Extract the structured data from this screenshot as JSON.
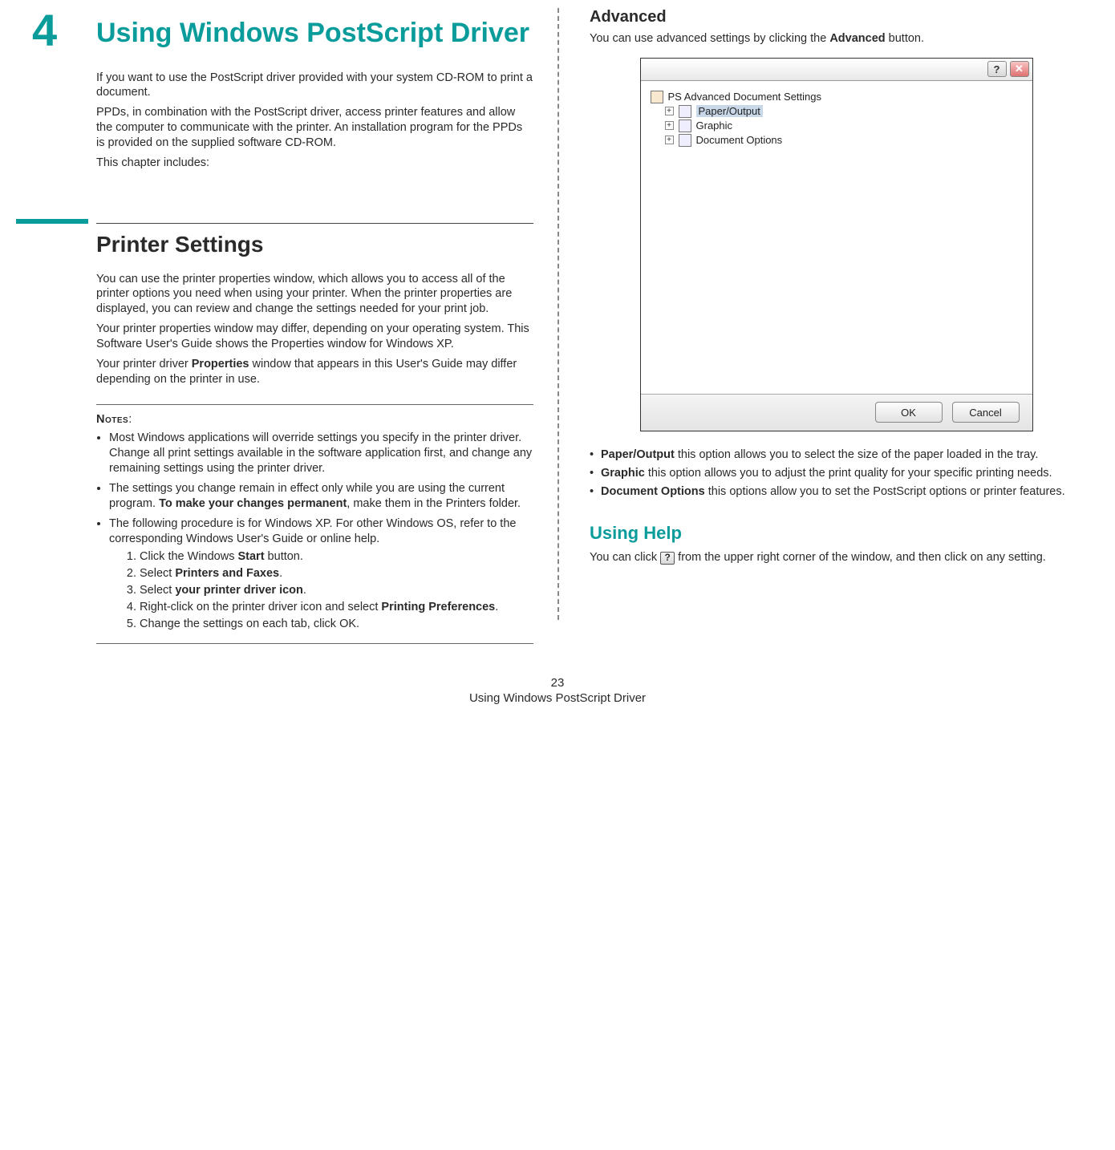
{
  "chapterNumber": "4",
  "chapterTitle": "Using Windows PostScript Driver",
  "intro1": "If you want to use the PostScript driver provided with your system CD-ROM to print a document.",
  "intro2": "PPDs, in combination with the PostScript driver, access printer features and allow the computer to communicate with the printer. An installation program for the PPDs is provided on the supplied software CD-ROM.",
  "intro3": "This chapter includes:",
  "section1_title": "Printer Settings",
  "section1_p1": "You can use the printer properties window, which allows you to access all of the printer options you need when using your printer. When the printer properties are displayed, you can review and change the settings needed for your print job.",
  "section1_p2": "Your printer properties window may differ, depending on your operating system. This Software User's Guide shows the Properties window for Windows XP.",
  "section1_p3a": "Your printer driver ",
  "section1_p3b": "Properties",
  "section1_p3c": " window that appears in this User's Guide may differ depending on the printer in use.",
  "notes_label": "Notes",
  "note1": "Most Windows applications will override settings you specify in the printer driver. Change all print settings available in the software application first, and change any remaining settings using the printer driver.",
  "note2a": "The settings you change remain in effect only while you are using the current program. ",
  "note2b": "To make your changes permanent",
  "note2c": ", make them in the Printers folder.",
  "note3": "The following procedure is for Windows XP. For other Windows OS, refer to the corresponding Windows User's Guide or online help.",
  "step1a": "Click the Windows ",
  "step1b": "Start",
  "step1c": " button.",
  "step2a": "Select ",
  "step2b": "Printers and Faxes",
  "step2c": ".",
  "step3a": "Select ",
  "step3b": "your printer driver icon",
  "step3c": ".",
  "step4a": "Right-click on the printer driver icon and select ",
  "step4b": "Printing Preferences",
  "step4c": ".",
  "step5": "Change the settings on each tab, click OK.",
  "adv_title": "Advanced",
  "adv_p1a": "You can use advanced settings by clicking the ",
  "adv_p1b": "Advanced",
  "adv_p1c": " button.",
  "dlg": {
    "help": "?",
    "close": "✕",
    "root": "PS Advanced Document Settings",
    "item1": "Paper/Output",
    "item2": "Graphic",
    "item3": "Document Options",
    "ok": "OK",
    "cancel": "Cancel"
  },
  "opt1b": "Paper/Output",
  "opt1c": " this option allows you to select the size of the paper loaded in the tray.",
  "opt2b": "Graphic",
  "opt2c": " this option allows you to adjust the print quality for your specific printing needs.",
  "opt3b": "Document Options",
  "opt3c": " this options allow you to set the PostScript options or printer features.",
  "help_title": "Using Help",
  "help_p1a": "You can click ",
  "help_icon": "?",
  "help_p1b": " from the upper right corner of the window, and then click on any setting.",
  "page_number": "23",
  "footer_title": "Using Windows PostScript Driver"
}
